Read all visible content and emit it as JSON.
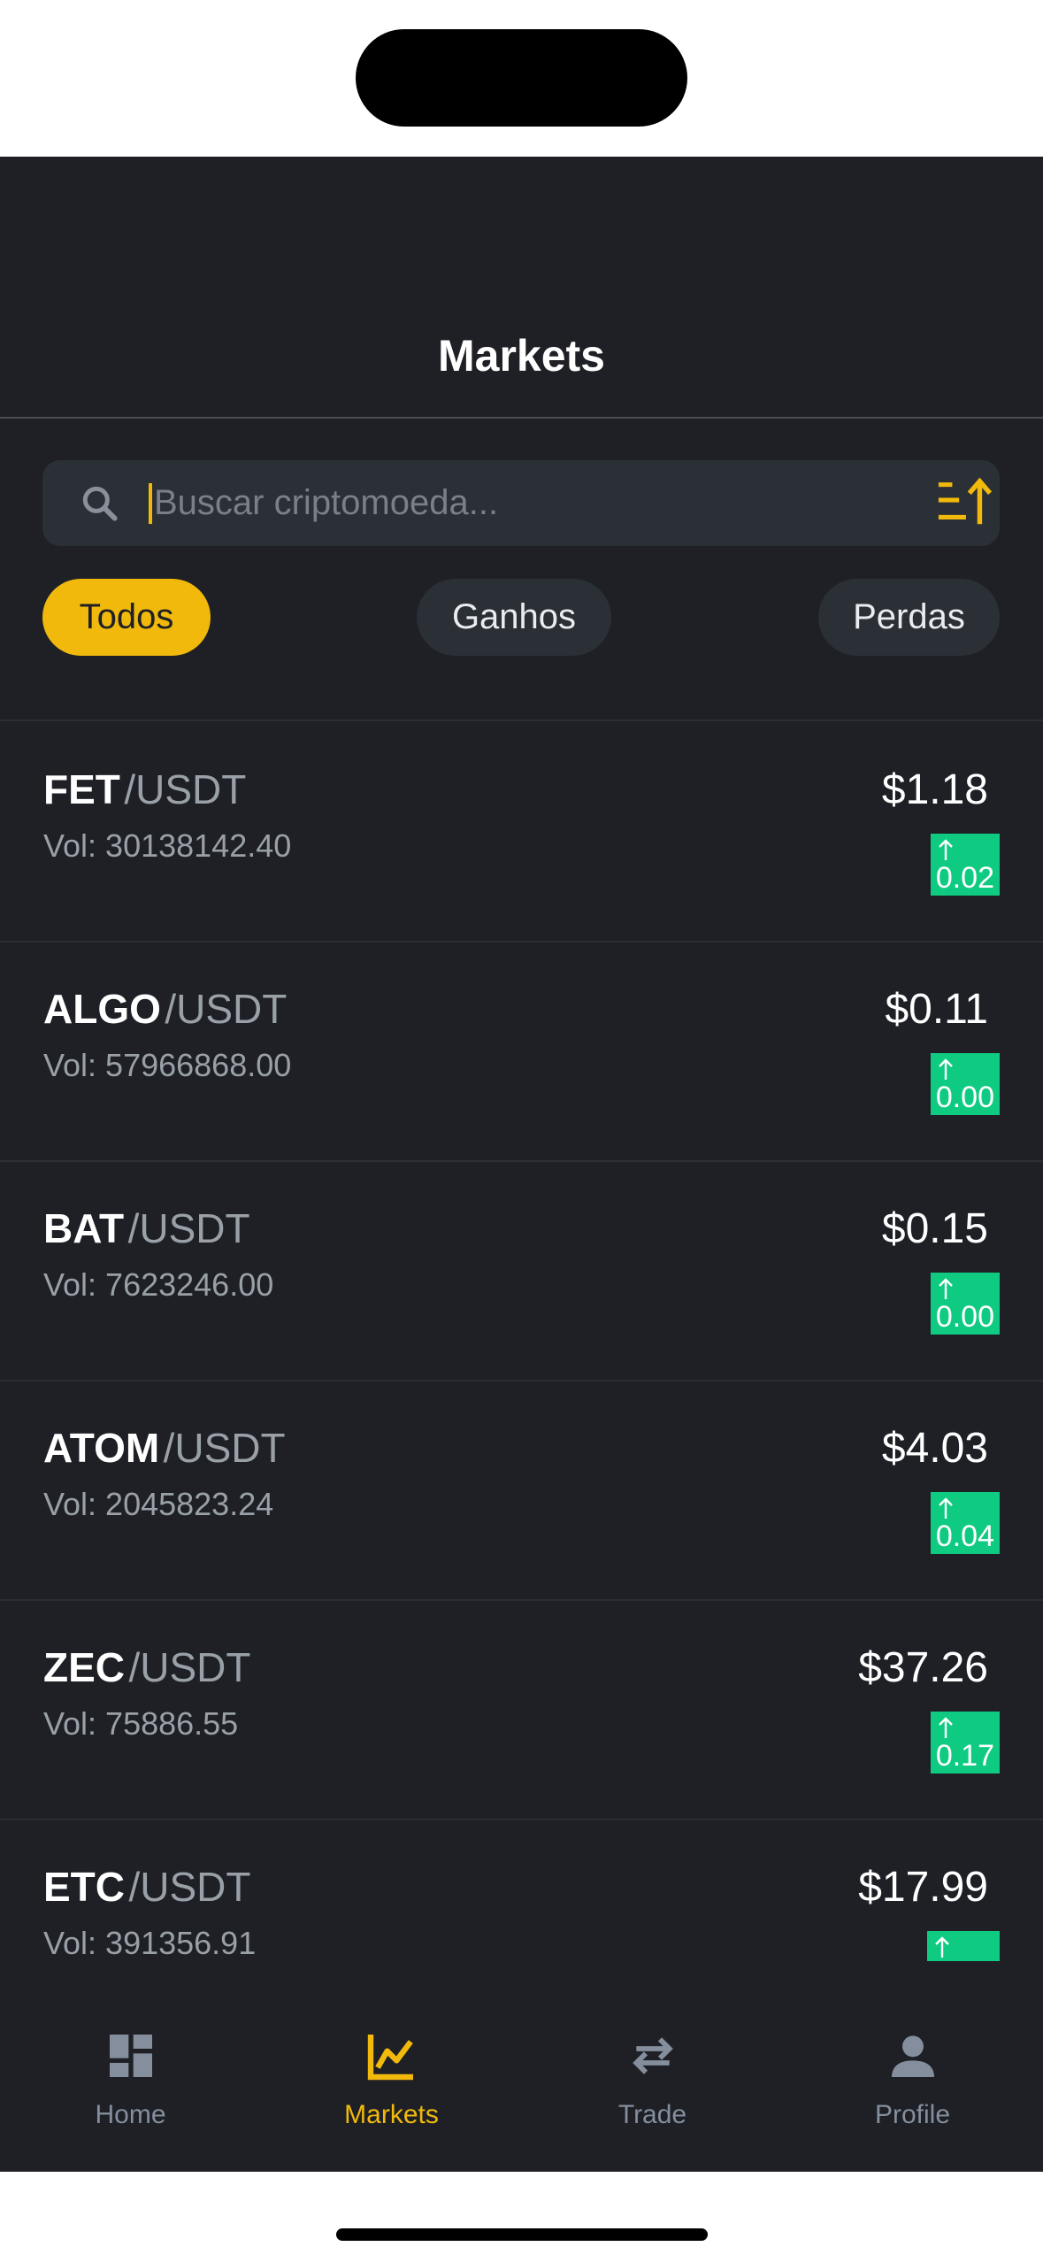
{
  "header": {
    "title": "Markets"
  },
  "search": {
    "placeholder": "Buscar criptomoeda...",
    "value": ""
  },
  "filters": [
    {
      "label": "Todos",
      "active": true
    },
    {
      "label": "Ganhos",
      "active": false
    },
    {
      "label": "Perdas",
      "active": false
    }
  ],
  "markets": [
    {
      "symbol": "FET",
      "quote": "/USDT",
      "volume": "Vol: 30138142.40",
      "price": "$1.18",
      "change": "0.02",
      "direction": "up"
    },
    {
      "symbol": "ALGO",
      "quote": "/USDT",
      "volume": "Vol: 57966868.00",
      "price": "$0.11",
      "change": "0.00",
      "direction": "up"
    },
    {
      "symbol": "BAT",
      "quote": "/USDT",
      "volume": "Vol: 7623246.00",
      "price": "$0.15",
      "change": "0.00",
      "direction": "up"
    },
    {
      "symbol": "ATOM",
      "quote": "/USDT",
      "volume": "Vol: 2045823.24",
      "price": "$4.03",
      "change": "0.04",
      "direction": "up"
    },
    {
      "symbol": "ZEC",
      "quote": "/USDT",
      "volume": "Vol: 75886.55",
      "price": "$37.26",
      "change": "0.17",
      "direction": "up"
    },
    {
      "symbol": "ETC",
      "quote": "/USDT",
      "volume": "Vol: 391356.91",
      "price": "$17.99",
      "change": "",
      "direction": "up"
    }
  ],
  "nav": [
    {
      "label": "Home",
      "icon": "dashboard-icon",
      "active": false
    },
    {
      "label": "Markets",
      "icon": "chart-line-icon",
      "active": true
    },
    {
      "label": "Trade",
      "icon": "swap-arrows-icon",
      "active": false
    },
    {
      "label": "Profile",
      "icon": "person-icon",
      "active": false
    }
  ],
  "colors": {
    "background": "#1e2026",
    "accent": "#f0b90b",
    "positive": "#0ecb81",
    "muted_text": "#848e9c"
  }
}
